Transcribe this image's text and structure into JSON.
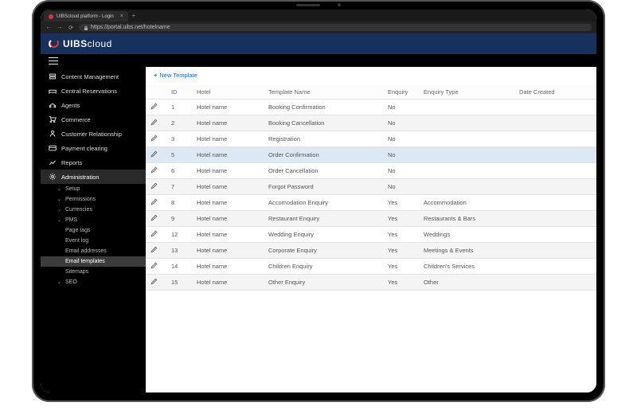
{
  "browser": {
    "tab_title": "UIBScloud platform - Login",
    "url": "https://portal.uibs.net/hotelname"
  },
  "brand": {
    "name_a": "UIBS",
    "name_b": "cloud"
  },
  "sidebar": {
    "items": [
      {
        "icon": "layers",
        "label": "Content Management"
      },
      {
        "icon": "bed",
        "label": "Central Reservations"
      },
      {
        "icon": "headset",
        "label": "Agents"
      },
      {
        "icon": "cart",
        "label": "Commerce"
      },
      {
        "icon": "person",
        "label": "Customer Relationship"
      },
      {
        "icon": "card",
        "label": "Payment clearing"
      },
      {
        "icon": "chart",
        "label": "Reports"
      },
      {
        "icon": "gear",
        "label": "Administration"
      }
    ],
    "sub": [
      {
        "label": "Setup",
        "caret": true
      },
      {
        "label": "Permissions",
        "caret": true
      },
      {
        "label": "Currencies",
        "caret": true
      },
      {
        "label": "PMS",
        "caret": true
      },
      {
        "label": "Page tags",
        "caret": false
      },
      {
        "label": "Event log",
        "caret": false
      },
      {
        "label": "Email addresses",
        "caret": false
      },
      {
        "label": "Email templates",
        "caret": false
      },
      {
        "label": "Sitemaps",
        "caret": false
      },
      {
        "label": "SEO",
        "caret": true
      }
    ],
    "active_index": 7,
    "sub_active_index": 7
  },
  "toolbar": {
    "new_template": "New Template"
  },
  "table": {
    "headers": {
      "edit": "",
      "id": "ID",
      "hotel": "Hotel",
      "template": "Template Name",
      "enquiry": "Enquiry",
      "enquiry_type": "Enquiry Type",
      "date": "Date Created"
    },
    "selected_index": 3,
    "rows": [
      {
        "id": "1",
        "hotel": "Hotel name",
        "template": "Booking Confirmation",
        "enquiry": "No",
        "etype": "",
        "date": ""
      },
      {
        "id": "2",
        "hotel": "Hotel name",
        "template": "Booking Cancellation",
        "enquiry": "No",
        "etype": "",
        "date": ""
      },
      {
        "id": "3",
        "hotel": "Hotel name",
        "template": "Registration",
        "enquiry": "No",
        "etype": "",
        "date": ""
      },
      {
        "id": "5",
        "hotel": "Hotel name",
        "template": "Order Confirmation",
        "enquiry": "No",
        "etype": "",
        "date": ""
      },
      {
        "id": "6",
        "hotel": "Hotel name",
        "template": "Order Cancellation",
        "enquiry": "No",
        "etype": "",
        "date": ""
      },
      {
        "id": "7",
        "hotel": "Hotel name",
        "template": "Forgot Password",
        "enquiry": "No",
        "etype": "",
        "date": ""
      },
      {
        "id": "8",
        "hotel": "Hotel name",
        "template": "Accomodation Enquiry",
        "enquiry": "Yes",
        "etype": "Accommodation",
        "date": ""
      },
      {
        "id": "9",
        "hotel": "Hotel name",
        "template": "Restaurant Enquiry",
        "enquiry": "Yes",
        "etype": "Restaurants & Bars",
        "date": ""
      },
      {
        "id": "12",
        "hotel": "Hotel name",
        "template": "Wedding Enquiry",
        "enquiry": "Yes",
        "etype": "Weddings",
        "date": ""
      },
      {
        "id": "13",
        "hotel": "Hotel name",
        "template": "Corporate Enquiry",
        "enquiry": "Yes",
        "etype": "Meetings & Events",
        "date": ""
      },
      {
        "id": "14",
        "hotel": "Hotel name",
        "template": "Children Enquiry",
        "enquiry": "Yes",
        "etype": "Children's Services",
        "date": ""
      },
      {
        "id": "15",
        "hotel": "Hotel name",
        "template": "Other Enquiry",
        "enquiry": "Yes",
        "etype": "Other",
        "date": ""
      }
    ]
  }
}
